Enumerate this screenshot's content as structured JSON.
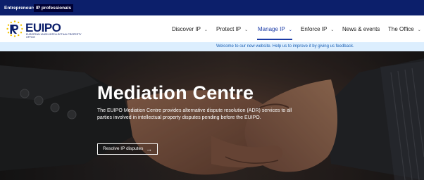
{
  "audience": {
    "entrepreneurs": "Entrepreneurs",
    "ip_professionals": "IP professionals"
  },
  "logo": {
    "name": "EUIPO",
    "subtitle": "EUROPEAN UNION INTELLECTUAL PROPERTY OFFICE"
  },
  "nav": {
    "items": [
      {
        "label": "Discover IP",
        "has_dropdown": true
      },
      {
        "label": "Protect IP",
        "has_dropdown": true
      },
      {
        "label": "Manage IP",
        "has_dropdown": true,
        "active": true
      },
      {
        "label": "Enforce IP",
        "has_dropdown": true
      },
      {
        "label": "News & events",
        "has_dropdown": false
      },
      {
        "label": "The Office",
        "has_dropdown": true
      }
    ],
    "chevron": "⌄"
  },
  "banner": {
    "text": "Welcome to our new website. Help us to improve it by giving us feedback."
  },
  "hero": {
    "title": "Mediation Centre",
    "description": "The EUIPO Mediation Centre provides alternative dispute resolution (ADR) services to all parties involved in intellectual property disputes pending before the EUIPO.",
    "button_label": "Resolve IP disputes",
    "button_icon": "arrow-right-icon"
  },
  "colors": {
    "brand_navy": "#0c1f6b",
    "active_nav": "#1a3aa6",
    "banner_bg": "#dceefe",
    "banner_text": "#1a5fb4"
  }
}
